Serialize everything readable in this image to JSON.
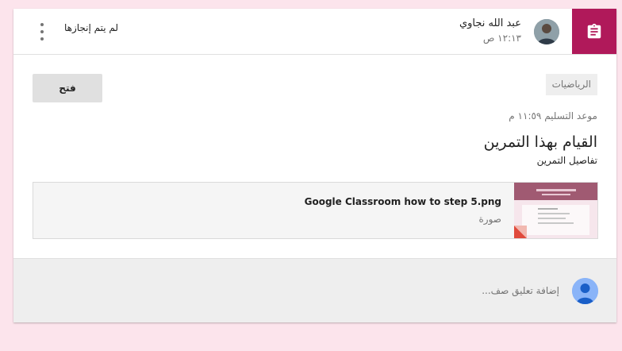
{
  "header": {
    "author_name": "عبد الله نجاوي",
    "post_time": "١٢:١٣ ص",
    "status": "لم يتم إنجازها",
    "type_icon": "assignment-icon",
    "more_icon": "more-vert-icon",
    "accent_color": "#b0195a"
  },
  "assignment": {
    "topic": "الرياضيات",
    "open_label": "فتح",
    "due": "موعد التسليم ١١:٥٩ م",
    "title": "القيام بهذا التمرين",
    "details": "تفاصيل التمرين"
  },
  "attachment": {
    "name": "Google Classroom how to step 5.png",
    "type": "صورة"
  },
  "comments": {
    "placeholder": "إضافة تعليق صف..."
  }
}
